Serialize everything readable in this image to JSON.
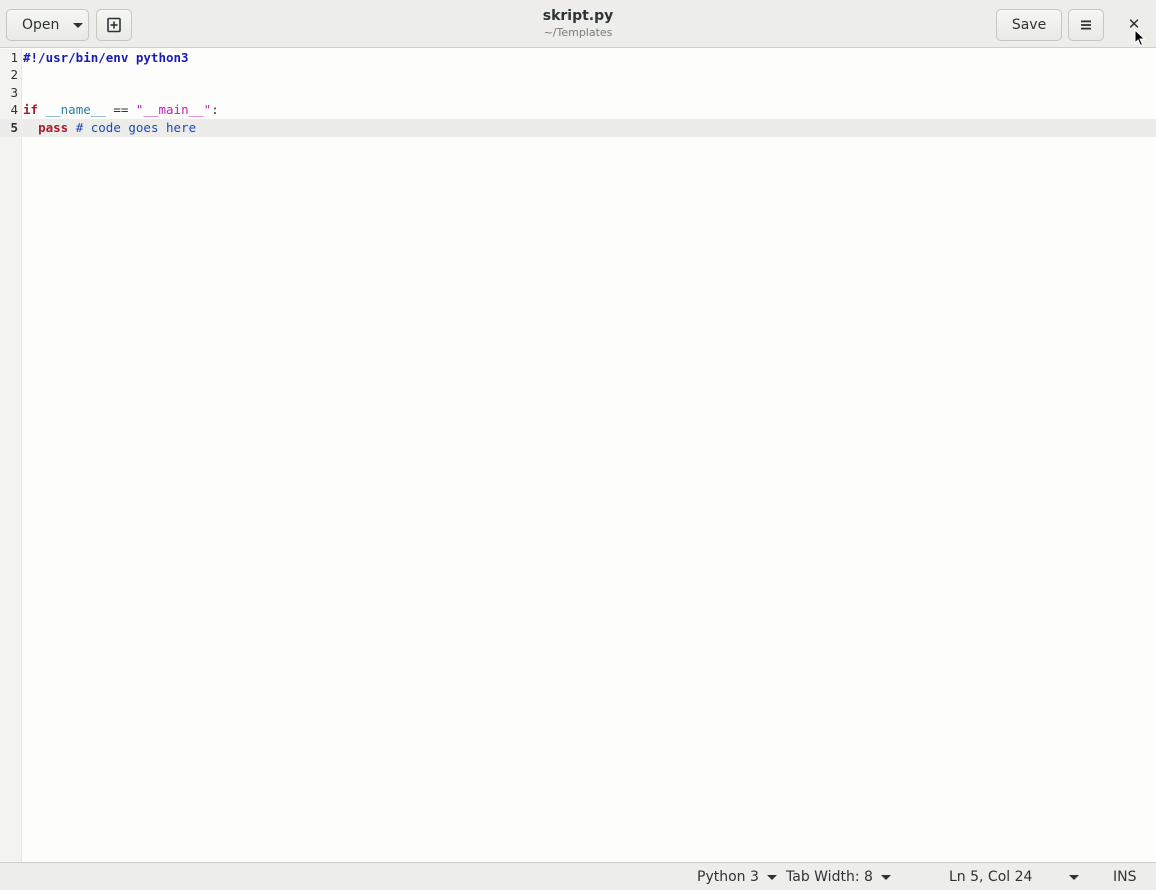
{
  "header": {
    "open_label": "Open",
    "save_label": "Save",
    "title": "skript.py",
    "subtitle": "~/Templates",
    "close_glyph": "✕"
  },
  "editor": {
    "current_line": 5,
    "lines": [
      {
        "num": "1",
        "tokens": [
          {
            "t": "#!/usr/bin/env python3",
            "c": "shebang"
          }
        ]
      },
      {
        "num": "2",
        "tokens": []
      },
      {
        "num": "3",
        "tokens": []
      },
      {
        "num": "4",
        "tokens": [
          {
            "t": "if",
            "c": "kw"
          },
          {
            "t": " ",
            "c": ""
          },
          {
            "t": "__name__",
            "c": "builtin"
          },
          {
            "t": " == ",
            "c": ""
          },
          {
            "t": "\"__main__\"",
            "c": "str"
          },
          {
            "t": ":",
            "c": ""
          }
        ]
      },
      {
        "num": "5",
        "tokens": [
          {
            "t": "  ",
            "c": ""
          },
          {
            "t": "pass",
            "c": "kw"
          },
          {
            "t": " ",
            "c": ""
          },
          {
            "t": "# code goes here",
            "c": "comment"
          }
        ]
      }
    ]
  },
  "statusbar": {
    "language": "Python 3",
    "tab_width": "Tab Width: 8",
    "position": "Ln 5, Col 24",
    "mode": "INS"
  },
  "icons": {
    "new_document": "new-document-icon",
    "menu": "hamburger-menu-icon",
    "close": "close-icon"
  },
  "colors": {
    "keyword": "#a51d2d",
    "string": "#c01fbf",
    "builtin": "#2a7fa5",
    "comment": "#1a4ab4",
    "shebang": "#1a1ab4"
  }
}
